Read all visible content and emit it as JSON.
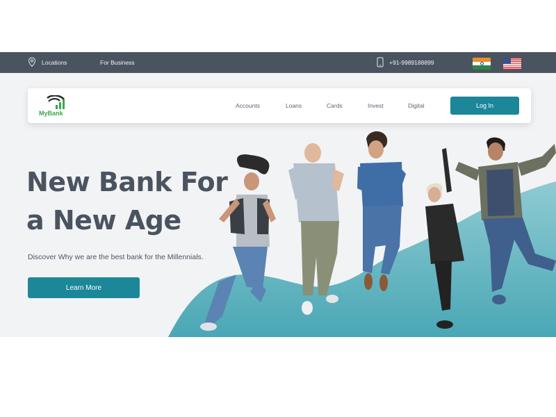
{
  "topbar": {
    "locations_label": "Locations",
    "business_label": "For Business",
    "phone": "+91-9989188899"
  },
  "brand": {
    "name": "MyBank"
  },
  "nav": {
    "items": [
      "Accounts",
      "Loans",
      "Cards",
      "Invest",
      "Digital"
    ],
    "login_label": "Log In"
  },
  "hero": {
    "title_line1": "New Bank For",
    "title_line2": "a New Age",
    "subtitle": "Discover Why we are the best bank for the Millennials.",
    "cta_label": "Learn More"
  },
  "colors": {
    "topbar": "#4a5460",
    "accent": "#1b8799",
    "wave": "#5fb3bf",
    "logo_green": "#3aa84a"
  },
  "icons": [
    "location-pin-icon",
    "phone-icon",
    "india-flag-icon",
    "usa-flag-icon",
    "mybank-logo-icon"
  ]
}
